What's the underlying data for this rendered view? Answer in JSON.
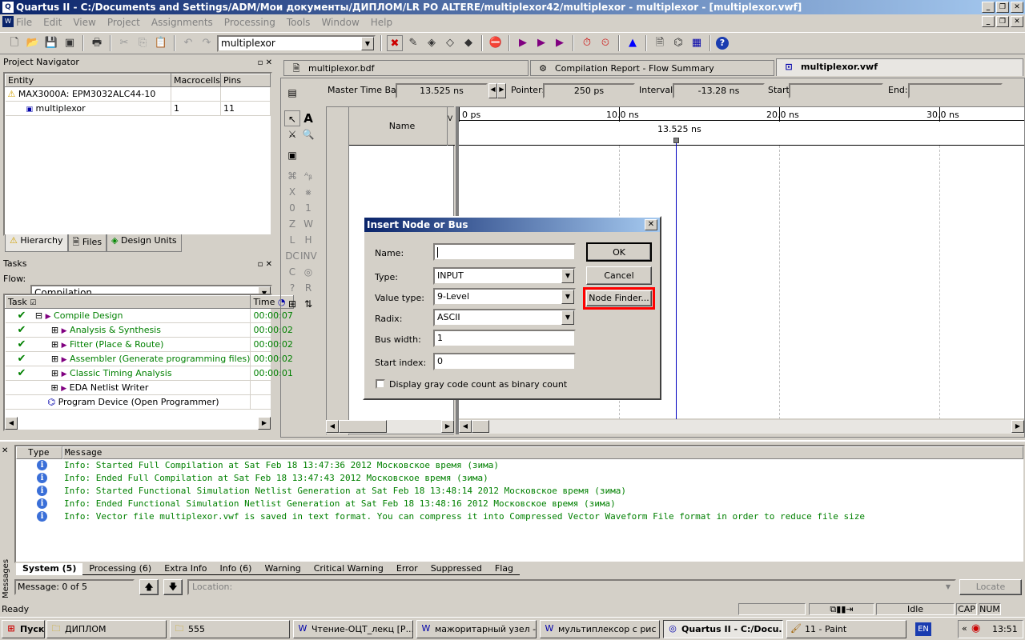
{
  "window": {
    "title": "Quartus II - C:/Documents and Settings/ADM/Мои документы/ДИПЛОМ/LR PO ALTERE/multiplexor42/multiplexor - multiplexor - [multiplexor.vwf]"
  },
  "menu": [
    "File",
    "Edit",
    "View",
    "Project",
    "Assignments",
    "Processing",
    "Tools",
    "Window",
    "Help"
  ],
  "toolbar": {
    "entity_combo": "multiplexor"
  },
  "navigator": {
    "title": "Project Navigator",
    "columns": [
      "Entity",
      "Macrocells",
      "Pins"
    ],
    "rows": [
      {
        "entity": "MAX3000A: EPM3032ALC44-10",
        "macrocells": "",
        "pins": ""
      },
      {
        "entity": "multiplexor",
        "macrocells": "1",
        "pins": "11"
      }
    ],
    "tabs": [
      "Hierarchy",
      "Files",
      "Design Units"
    ]
  },
  "tasks": {
    "title": "Tasks",
    "flow_label": "Flow:",
    "flow_value": "Compilation",
    "columns": [
      "Task",
      "Time"
    ],
    "rows": [
      {
        "name": "Compile Design",
        "time": "00:00:07",
        "done": true
      },
      {
        "name": "Analysis & Synthesis",
        "time": "00:00:02",
        "done": true
      },
      {
        "name": "Fitter (Place & Route)",
        "time": "00:00:02",
        "done": true
      },
      {
        "name": "Assembler (Generate programming files)",
        "time": "00:00:02",
        "done": true
      },
      {
        "name": "Classic Timing Analysis",
        "time": "00:00:01",
        "done": true
      },
      {
        "name": "EDA Netlist Writer",
        "time": "",
        "done": false
      },
      {
        "name": "Program Device (Open Programmer)",
        "time": "",
        "done": false
      }
    ]
  },
  "doc_tabs": [
    "multiplexor.bdf",
    "Compilation Report - Flow Summary",
    "multiplexor.vwf"
  ],
  "waveform": {
    "master_label": "Master Time Bar:",
    "master_value": "13.525 ns",
    "pointer_label": "Pointer:",
    "pointer_value": "250 ps",
    "interval_label": "Interval:",
    "interval_value": "-13.28 ns",
    "start_label": "Start:",
    "end_label": "End:",
    "name_header": "Name",
    "value_header": "V",
    "time_ticks": [
      "0 ps",
      "10.0 ns",
      "20.0 ns",
      "30.0 ns"
    ],
    "cursor_label": "13.525 ns"
  },
  "dialog": {
    "title": "Insert Node or Bus",
    "name_label": "Name:",
    "name_value": "",
    "type_label": "Type:",
    "type_value": "INPUT",
    "valuetype_label": "Value type:",
    "valuetype_value": "9-Level",
    "radix_label": "Radix:",
    "radix_value": "ASCII",
    "buswidth_label": "Bus width:",
    "buswidth_value": "1",
    "startindex_label": "Start index:",
    "startindex_value": "0",
    "checkbox_label": "Display gray code count as binary count",
    "ok": "OK",
    "cancel": "Cancel",
    "node_finder": "Node Finder..."
  },
  "messages": {
    "columns": [
      "Type",
      "Message"
    ],
    "rows": [
      "Info: Started Full Compilation at Sat Feb 18 13:47:36 2012 Московское время (зима)",
      "Info: Ended Full Compilation at Sat Feb 18 13:47:43 2012 Московское время (зима)",
      "Info: Started Functional Simulation Netlist Generation at Sat Feb 18 13:48:14 2012 Московское время (зима)",
      "Info: Ended Functional Simulation Netlist Generation at Sat Feb 18 13:48:16 2012 Московское время (зима)",
      "Info: Vector file multiplexor.vwf is saved in text format. You can compress it into Compressed Vector Waveform File format in order to reduce file size"
    ],
    "tabs": [
      "System (5)",
      "Processing (6)",
      "Extra Info",
      "Info (6)",
      "Warning",
      "Critical Warning",
      "Error",
      "Suppressed",
      "Flag"
    ],
    "side_label": "Messages",
    "count": "Message: 0 of 5",
    "location_placeholder": "Location:",
    "locate": "Locate"
  },
  "status": {
    "ready": "Ready",
    "idle": "Idle",
    "cap": "CAP",
    "num": "NUM"
  },
  "taskbar": {
    "start": "Пуск",
    "items": [
      "ДИПЛОМ",
      "555",
      "Чтение-ОЦТ_лекц [Р...",
      "мажоритарный узел -...",
      "мультиплексор с рис ...",
      "Quartus II - C:/Docu...",
      "11 - Paint"
    ],
    "lang": "EN",
    "clock": "13:51"
  },
  "colors": {
    "highlight_border": "#ff0000",
    "title_blue": "#0a246a",
    "info_green": "#008000"
  }
}
